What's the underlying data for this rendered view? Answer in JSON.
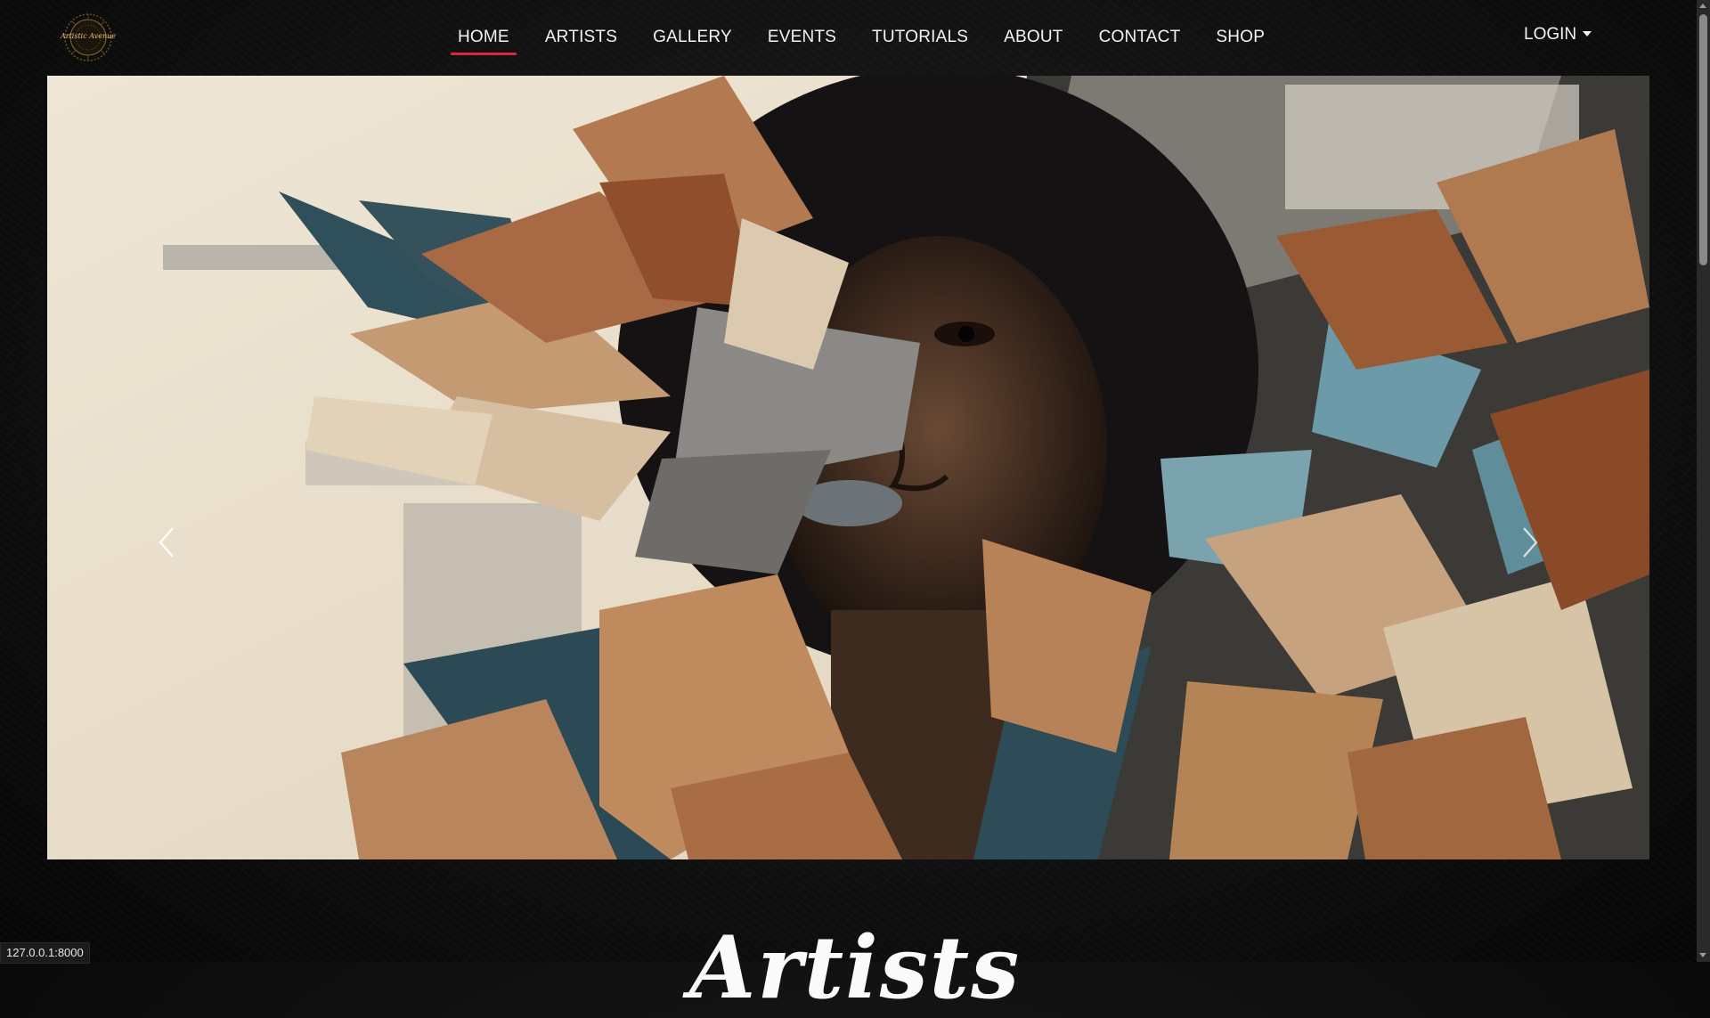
{
  "brand": {
    "logo_text": "Artistic Avenue"
  },
  "nav": {
    "items": [
      {
        "label": "HOME",
        "active": true
      },
      {
        "label": "ARTISTS"
      },
      {
        "label": "GALLERY"
      },
      {
        "label": "EVENTS"
      },
      {
        "label": "TUTORIALS"
      },
      {
        "label": "ABOUT"
      },
      {
        "label": "CONTACT"
      },
      {
        "label": "SHOP"
      }
    ],
    "login_label": "LOGIN",
    "active_color": "#e0263c"
  },
  "hero": {
    "image": "paper-collage-woman-portrait",
    "prev_icon": "chevron-left-icon",
    "next_icon": "chevron-right-icon"
  },
  "section": {
    "heading": "Artists"
  },
  "status": {
    "url": "127.0.0.1:8000"
  }
}
